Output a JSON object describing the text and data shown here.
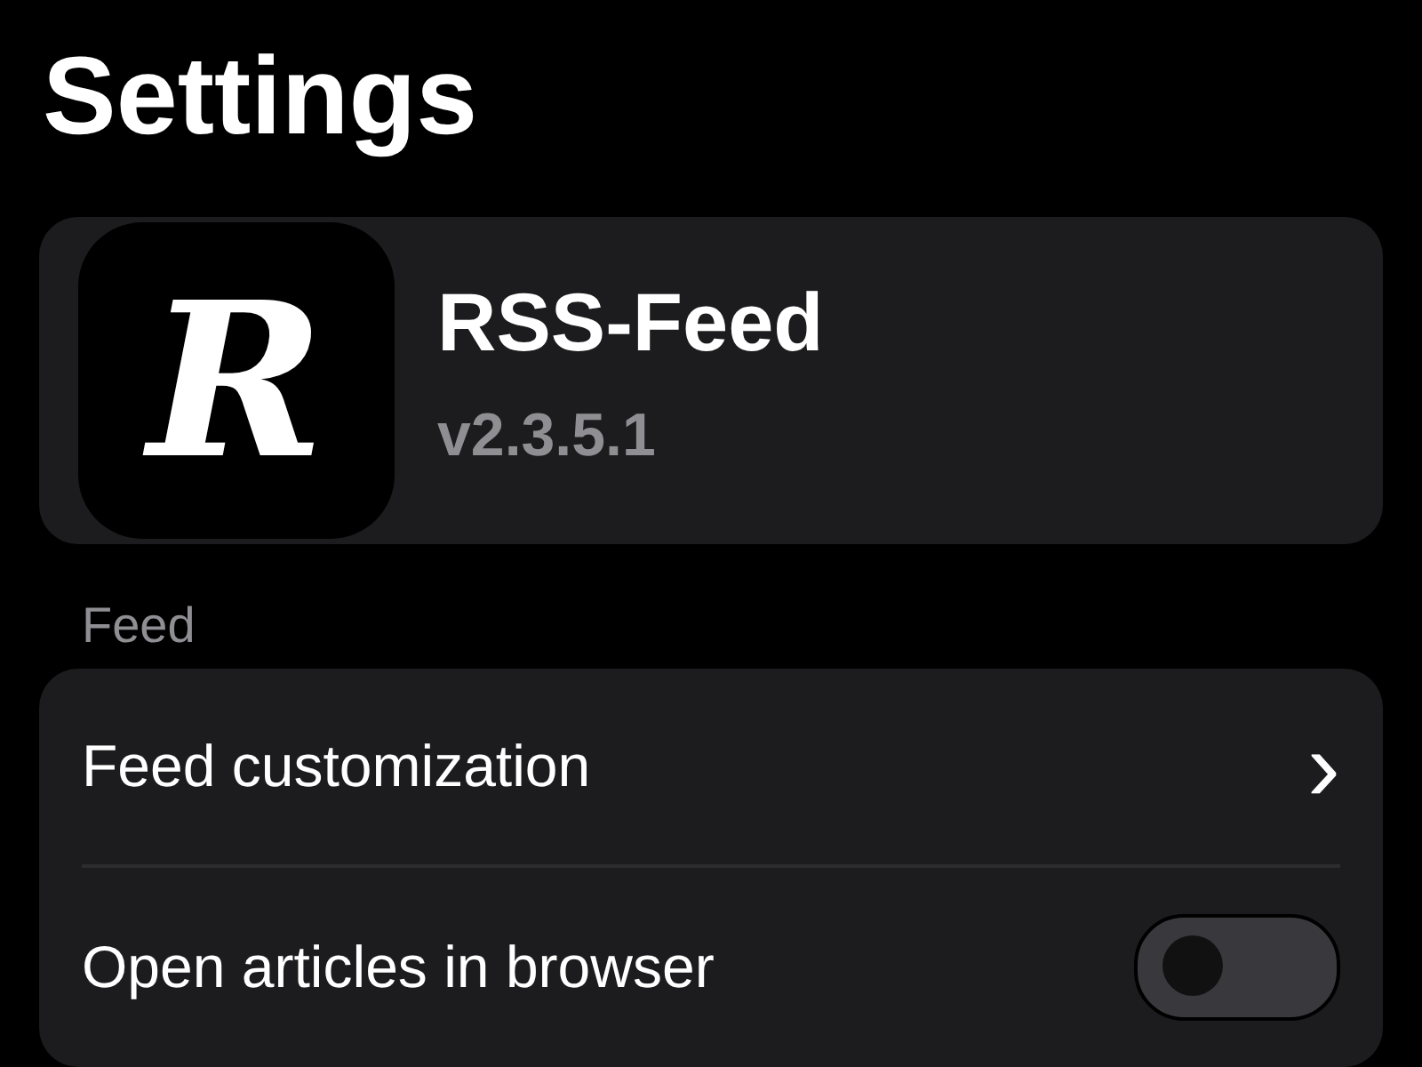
{
  "title": "Settings",
  "app": {
    "logo_letter": "R",
    "name": "RSS-Feed",
    "version": "v2.3.5.1"
  },
  "section": {
    "header": "Feed",
    "rows": [
      {
        "kind": "link",
        "label": "Feed customization",
        "chevron": "›"
      },
      {
        "kind": "toggle",
        "label": "Open articles in browser",
        "on": false
      }
    ]
  }
}
